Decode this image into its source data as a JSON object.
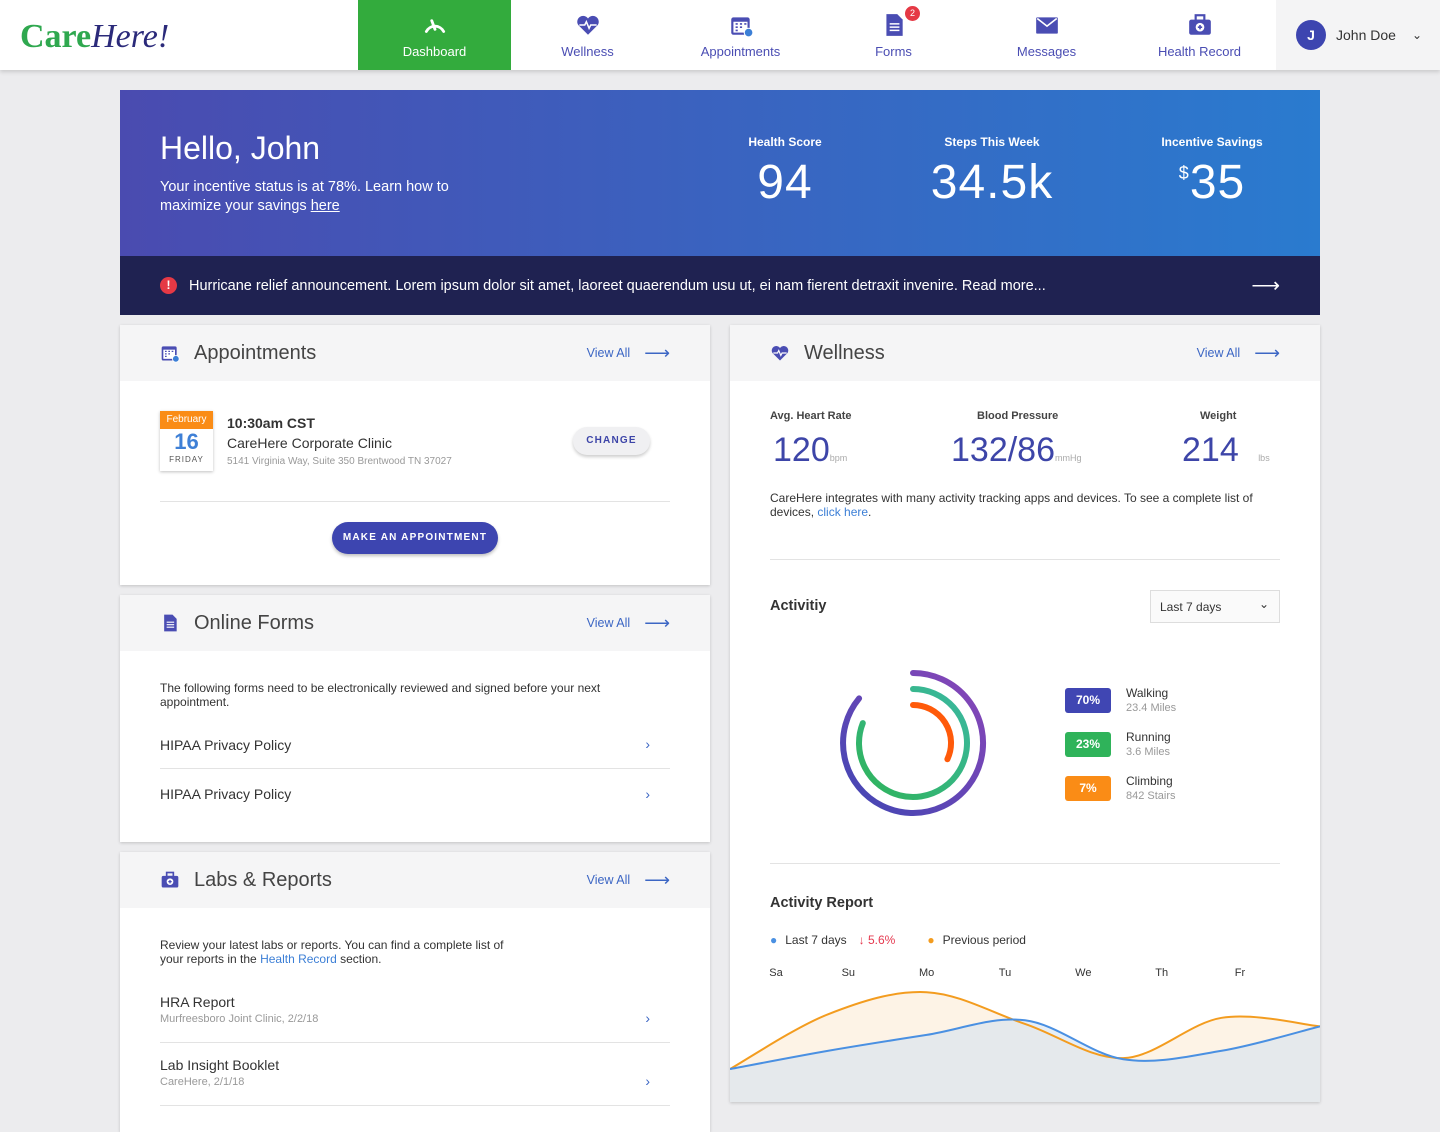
{
  "brand": {
    "logo_text_a": "Care",
    "logo_text_b": "Here!"
  },
  "nav": [
    {
      "label": "Dashboard",
      "icon": "gauge-icon"
    },
    {
      "label": "Wellness",
      "icon": "heart-pulse-icon"
    },
    {
      "label": "Appointments",
      "icon": "calendar-icon"
    },
    {
      "label": "Forms",
      "icon": "document-icon",
      "badge": "2"
    },
    {
      "label": "Messages",
      "icon": "envelope-icon"
    },
    {
      "label": "Health Record",
      "icon": "medical-kit-icon"
    }
  ],
  "user": {
    "initial": "J",
    "name": "John Doe"
  },
  "hero": {
    "greeting": "Hello, John",
    "message": "Your incentive status is at 78%. Learn how to maximize your savings ",
    "link": "here",
    "stats": [
      {
        "label": "Health Score",
        "value": "94"
      },
      {
        "label": "Steps This Week",
        "value": "34.5k"
      },
      {
        "label": "Incentive Savings",
        "currency": "$",
        "value": "35"
      }
    ]
  },
  "announcement": "Hurricane relief announcement. Lorem ipsum dolor sit amet, laoreet quaerendum usu ut, ei nam fierent detraxit invenire. Read more...",
  "appointments": {
    "title": "Appointments",
    "view_all": "View All",
    "month": "February",
    "day": "16",
    "weekday": "FRIDAY",
    "time": "10:30am CST",
    "clinic": "CareHere Corporate Clinic",
    "address": "5141 Virginia Way, Suite 350 Brentwood TN 37027",
    "change": "CHANGE",
    "make": "MAKE AN APPOINTMENT"
  },
  "forms": {
    "title": "Online Forms",
    "view_all": "View All",
    "intro": "The following forms need to be electronically reviewed and signed before your next appointment.",
    "items": [
      "HIPAA Privacy Policy",
      "HIPAA Privacy Policy"
    ]
  },
  "labs": {
    "title": "Labs & Reports",
    "view_all": "View All",
    "intro_a": "Review your latest labs or reports. You can find a complete list of your reports in the ",
    "intro_link": "Health Record",
    "intro_b": " section.",
    "items": [
      {
        "title": "HRA Report",
        "sub": "Murfreesboro Joint Clinic, 2/2/18"
      },
      {
        "title": "Lab Insight Booklet",
        "sub": "CareHere, 2/1/18"
      }
    ]
  },
  "wellness": {
    "title": "Wellness",
    "view_all": "View All",
    "metrics": [
      {
        "label": "Avg. Heart Rate",
        "value": "120",
        "unit": "bpm"
      },
      {
        "label": "Blood Pressure",
        "value": "132/86",
        "unit": "mmHg"
      },
      {
        "label": "Weight",
        "value": "214",
        "unit": "lbs"
      }
    ],
    "note": "CareHere integrates with many activity tracking apps and devices. To see a complete list of devices, ",
    "note_link": "click here",
    "note_end": ".",
    "activity_title": "Activitiy",
    "range": "Last 7 days",
    "activities": [
      {
        "pct": "70%",
        "fraction": 0.7,
        "name": "Walking",
        "detail": "23.4 Miles",
        "color": "#4046b3"
      },
      {
        "pct": "23%",
        "fraction": 0.23,
        "name": "Running",
        "detail": "3.6 Miles",
        "color": "#2fb35a"
      },
      {
        "pct": "7%",
        "fraction": 0.07,
        "name": "Climbing",
        "detail": "842 Stairs",
        "color": "#fa8c16"
      }
    ],
    "report_title": "Activity Report"
  },
  "chart_data": {
    "type": "area",
    "categories": [
      "Sa",
      "Su",
      "Mo",
      "Tu",
      "We",
      "Th",
      "Fr"
    ],
    "series": [
      {
        "name": "Last 7 days",
        "change": "↓ 5.6%",
        "color": "#4a90e2",
        "values": [
          27,
          42,
          55,
          67,
          35,
          42,
          62
        ]
      },
      {
        "name": "Previous period",
        "color": "#f39c1f",
        "values": [
          27,
          72,
          90,
          64,
          36,
          69,
          62
        ]
      }
    ],
    "ylim": [
      0,
      100
    ]
  }
}
